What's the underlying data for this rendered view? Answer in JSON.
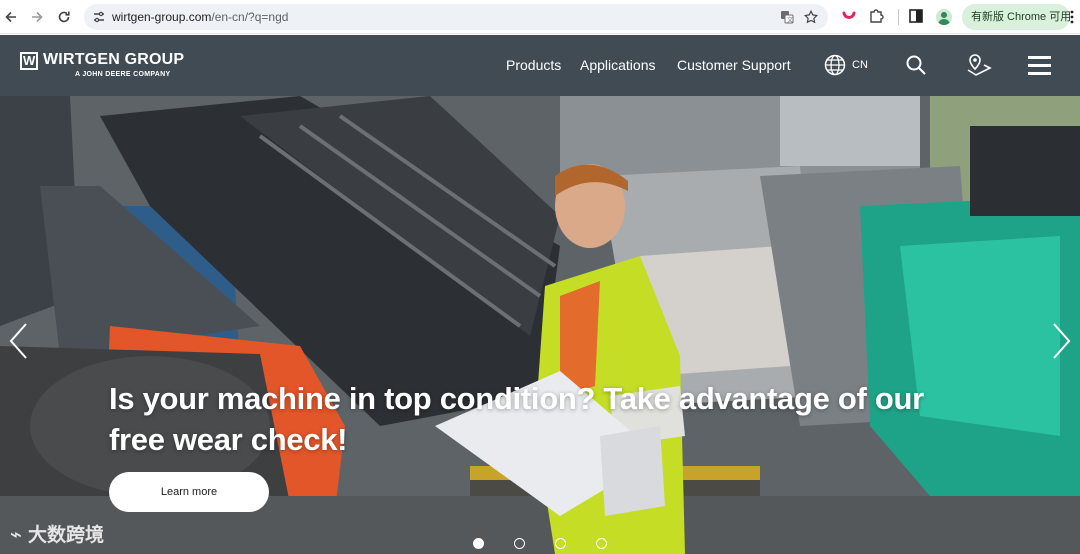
{
  "browser": {
    "url_host": "wirtgen-group.com",
    "url_path": "/en-cn/?q=ngd",
    "profile_pill": "有新版 Chrome 可用",
    "icons": [
      "back-icon",
      "forward-icon",
      "reload-icon",
      "site-info-icon",
      "translate-icon",
      "bookmark-star-icon",
      "extension-icon",
      "puzzle-icon",
      "side-panel-icon",
      "avatar",
      "kebab-menu-icon"
    ]
  },
  "header": {
    "logo_text": "WIRTGEN GROUP",
    "logo_sub": "A JOHN DEERE COMPANY",
    "nav": [
      "Products",
      "Applications",
      "Customer Support"
    ],
    "lang": "CN",
    "colors": {
      "header_bg": "#414b54",
      "text": "#ffffff"
    }
  },
  "hero": {
    "headline": "Is your machine in top condition? Take advantage of our free wear check!",
    "cta": "Learn more",
    "slides_count": 4,
    "active_slide": 1,
    "watermark": "大数跨境"
  }
}
